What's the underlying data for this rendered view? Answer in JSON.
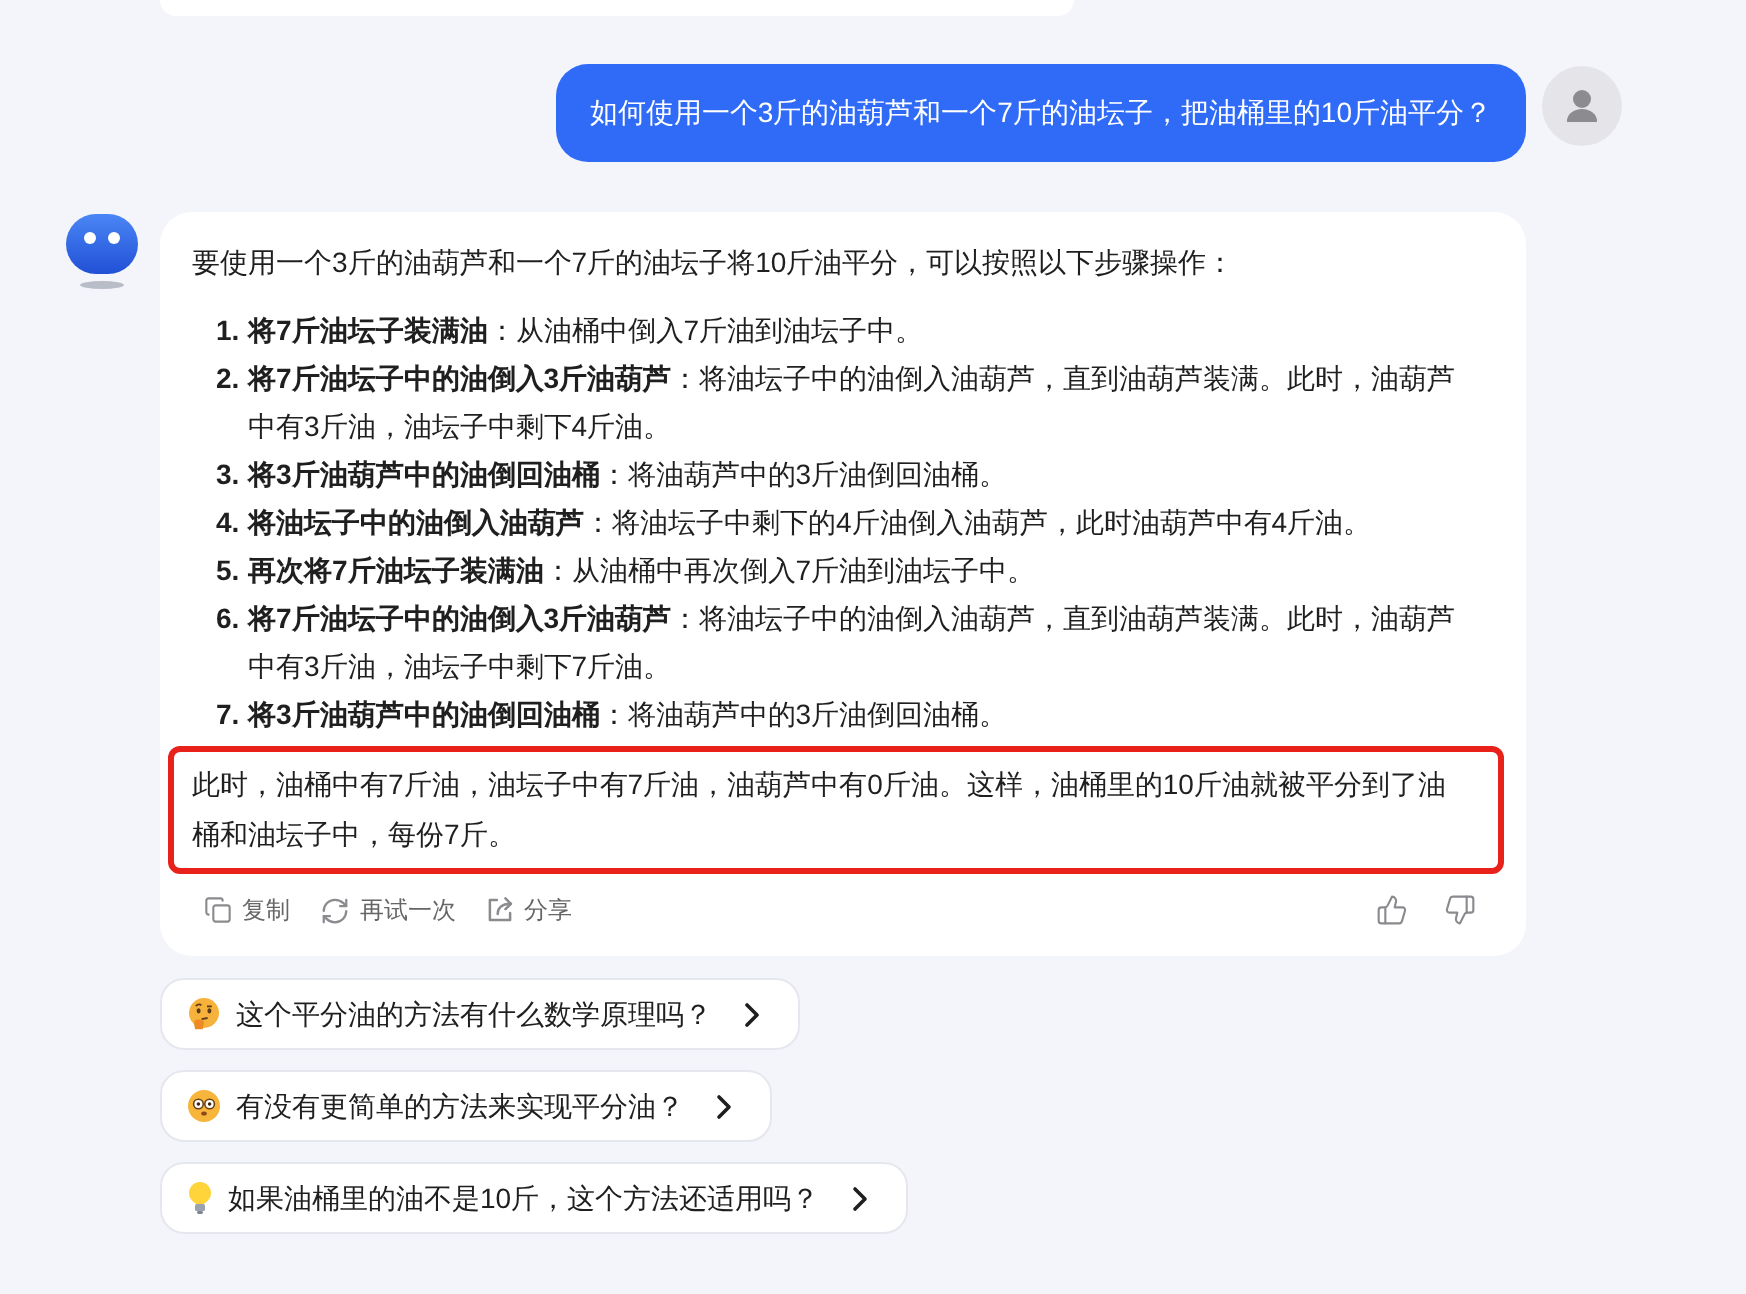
{
  "user_message": {
    "text": "如何使用一个3斤的油葫芦和一个7斤的油坛子，把油桶里的10斤油平分？"
  },
  "bot_message": {
    "intro": "要使用一个3斤的油葫芦和一个7斤的油坛子将10斤油平分，可以按照以下步骤操作：",
    "steps": [
      {
        "number": "1.",
        "text": "**将7斤油坛子装满油**：从油桶中倒入7斤油到油坛子中。"
      },
      {
        "number": "2.",
        "text": "**将7斤油坛子中的油倒入3斤油葫芦**：将油坛子中的油倒入油葫芦，直到油葫芦装满。此时，油葫芦中有3斤油，油坛子中剩下4斤油。"
      },
      {
        "number": "3.",
        "text": "**将3斤油葫芦中的油倒回油桶**：将油葫芦中的3斤油倒回油桶。"
      },
      {
        "number": "4.",
        "text": "**将油坛子中的油倒入油葫芦**：将油坛子中剩下的4斤油倒入油葫芦，此时油葫芦中有4斤油。"
      },
      {
        "number": "5.",
        "text": "**再次将7斤油坛子装满油**：从油桶中再次倒入7斤油到油坛子中。"
      },
      {
        "number": "6.",
        "text": "**将7斤油坛子中的油倒入3斤油葫芦**：将油坛子中的油倒入油葫芦，直到油葫芦装满。此时，油葫芦中有3斤油，油坛子中剩下7斤油。"
      },
      {
        "number": "7.",
        "text": "**将3斤油葫芦中的油倒回油桶**：将油葫芦中的3斤油倒回油桶。"
      }
    ],
    "conclusion": {
      "text": "此时，油桶中有7斤油，油坛子中有7斤油，油葫芦中有0斤油。这样，油桶里的10斤油就被平分到了油桶和油坛子中，每份7斤。",
      "highlighted": true
    },
    "actions": [
      {
        "label": "复制"
      },
      {
        "label": "再试一次"
      },
      {
        "label": "分享"
      }
    ]
  },
  "suggestions": [
    {
      "text": "这个平分油的方法有什么数学原理吗？"
    },
    {
      "text": "有没有更简单的方法来实现平分油？"
    },
    {
      "text": "如果油桶里的油不是10斤，这个方法还适用吗？"
    }
  ]
}
